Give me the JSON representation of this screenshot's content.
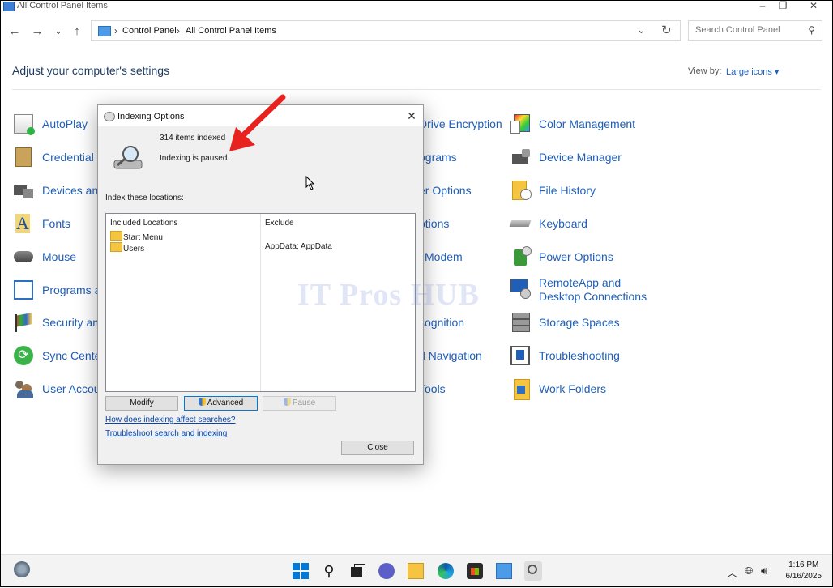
{
  "window": {
    "title": "All Control Panel Items"
  },
  "address_bar": {
    "crumbs": [
      "Control Panel",
      "All Control Panel Items"
    ]
  },
  "search": {
    "placeholder": "Search Control Panel"
  },
  "page": {
    "heading": "Adjust your computer's settings",
    "view_by_label": "View by:",
    "view_by_value": "Large icons"
  },
  "items": {
    "col1": [
      "AutoPlay",
      "Credential M",
      "Devices and",
      "Fonts",
      "Mouse",
      "Programs ar",
      "Security and",
      "Sync Center",
      "User Accour"
    ],
    "col2": [
      "Drive Encryption",
      "ograms",
      "er Options",
      "ptions",
      "Modem",
      "",
      "cognition",
      "d Navigation",
      "Tools"
    ],
    "col3": [
      "Color Management",
      "Device Manager",
      "File History",
      "Keyboard",
      "Power Options",
      "RemoteApp and Desktop Connections",
      "Storage Spaces",
      "Troubleshooting",
      "Work Folders"
    ]
  },
  "dialog": {
    "title": "Indexing Options",
    "items_indexed": "314 items indexed",
    "status": "Indexing is paused.",
    "index_label": "Index these locations:",
    "col_included": "Included Locations",
    "col_exclude": "Exclude",
    "locations": [
      {
        "name": "Start Menu",
        "exclude": ""
      },
      {
        "name": "Users",
        "exclude": "AppData; AppData"
      }
    ],
    "buttons": {
      "modify": "Modify",
      "advanced": "Advanced",
      "pause": "Pause",
      "close": "Close"
    },
    "links": {
      "how": "How does indexing affect searches?",
      "troubleshoot": "Troubleshoot search and indexing"
    }
  },
  "watermark": "IT Pros HUB",
  "taskbar": {
    "time": "1:16 PM",
    "date": "6/16/2025"
  },
  "colors": {
    "link": "#1f5fb8",
    "arrow": "#e8231f",
    "accent": "#0078d7"
  }
}
